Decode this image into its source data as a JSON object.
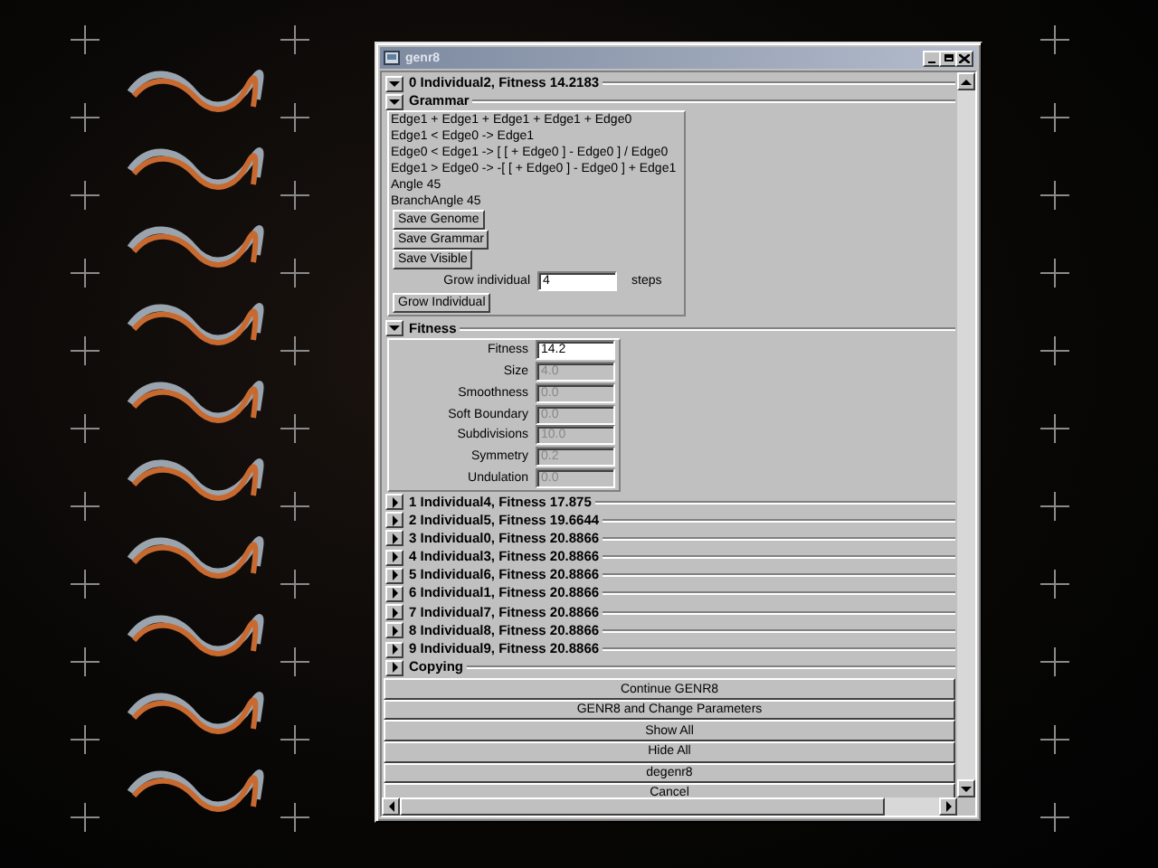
{
  "window": {
    "title": "genr8"
  },
  "individuals": [
    {
      "label": "0 Individual2, Fitness 14.2183",
      "expanded": true,
      "grammar": {
        "label": "Grammar",
        "expanded": true,
        "lines": [
          "Edge1 + Edge1 + Edge1 + Edge1 + Edge0",
          "Edge1 < Edge0 -> Edge1",
          "Edge0 < Edge1 -> [ [ + Edge0 ] - Edge0 ] / Edge0",
          "Edge1 > Edge0 -> -[ [ + Edge0 ] - Edge0 ] + Edge1",
          "Angle 45",
          "BranchAngle 45"
        ],
        "buttons": [
          "Save Genome",
          "Save Grammar",
          "Save Visible"
        ],
        "grow": {
          "label": "Grow individual",
          "value": "4",
          "unit": "steps"
        },
        "grow_button": "Grow Individual"
      },
      "fitness": {
        "label": "Fitness",
        "expanded": true,
        "fields": [
          {
            "label": "Fitness",
            "value": "14.2",
            "disabled": false
          },
          {
            "label": "Size",
            "value": "4.0",
            "disabled": true
          },
          {
            "label": "Smoothness",
            "value": "0.0",
            "disabled": true
          },
          {
            "label": "Soft Boundary",
            "value": "0.0",
            "disabled": true
          },
          {
            "label": "Subdivisions",
            "value": "10.0",
            "disabled": true
          },
          {
            "label": "Symmetry",
            "value": "0.2",
            "disabled": true
          },
          {
            "label": "Undulation",
            "value": "0.0",
            "disabled": true
          }
        ]
      }
    },
    {
      "label": "1 Individual4, Fitness 17.875",
      "expanded": false
    },
    {
      "label": "2 Individual5, Fitness 19.6644",
      "expanded": false
    },
    {
      "label": "3 Individual0, Fitness 20.8866",
      "expanded": false
    },
    {
      "label": "4 Individual3, Fitness 20.8866",
      "expanded": false
    },
    {
      "label": "5 Individual6, Fitness 20.8866",
      "expanded": false
    },
    {
      "label": "6 Individual1, Fitness 20.8866",
      "expanded": false
    },
    {
      "label": "7 Individual7, Fitness 20.8866",
      "expanded": false
    },
    {
      "label": "8 Individual8, Fitness 20.8866",
      "expanded": false
    },
    {
      "label": "9 Individual9, Fitness 20.8866",
      "expanded": false
    }
  ],
  "copying": {
    "label": "Copying",
    "expanded": false
  },
  "buttons": [
    "Continue GENR8",
    "GENR8 and Change Parameters",
    "Show All",
    "Hide All",
    "degenr8",
    "Cancel"
  ]
}
